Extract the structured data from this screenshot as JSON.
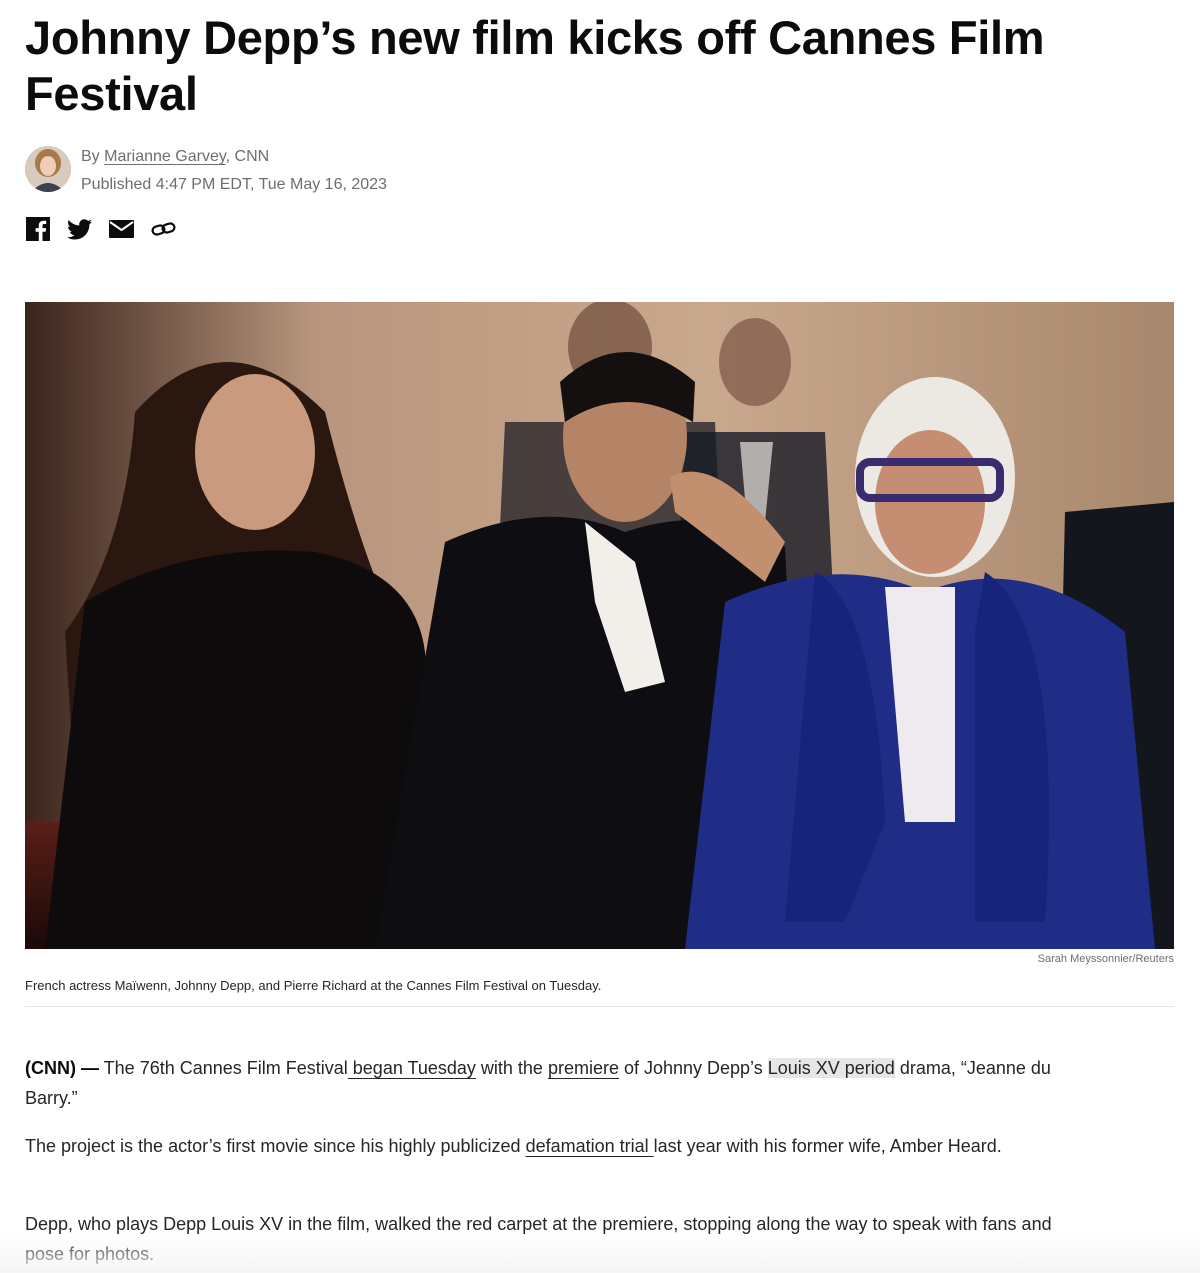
{
  "article": {
    "headline": "Johnny Depp’s new film kicks off Cannes Film Festival",
    "byline": {
      "prefix": "By ",
      "author": "Marianne Garvey",
      "outlet": ", CNN",
      "published": "Published 4:47 PM EDT, Tue May 16, 2023"
    },
    "share": [
      "facebook-icon",
      "twitter-icon",
      "email-icon",
      "link-icon"
    ],
    "image": {
      "credit": "Sarah Meyssonnier/Reuters",
      "caption": "French actress Maïwenn, Johnny Depp, and Pierre Richard at the Cannes Film Festival on Tuesday."
    },
    "paragraphs": {
      "p1": {
        "lead": "(CNN) —",
        "t1": " The 76th Cannes Film Festival",
        "link1": " began Tuesday",
        "t2": " with the ",
        "link2": "premiere",
        "t3": " of Johnny Depp’s ",
        "highlight": "Louis XV period",
        "t4": " drama, “Jeanne du Barry.”"
      },
      "p2": {
        "t1": "The project is the actor’s first movie since his highly publicized ",
        "link1": "defamation trial ",
        "t2": "last year with his former wife, Amber Heard."
      },
      "p3": {
        "t1": "Depp, who plays Depp Louis XV in the film, walked the red carpet at the premiere, stopping along the way to speak with fans and pose for photos."
      }
    }
  },
  "colors": {
    "text": "#0c0c0c",
    "muted": "#6e6e6e",
    "highlight": "#e6e6e6"
  }
}
